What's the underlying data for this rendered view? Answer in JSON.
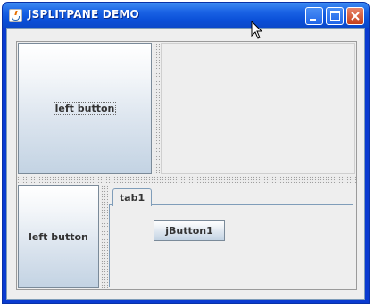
{
  "window": {
    "title": "JSPLITPANE DEMO",
    "controls": [
      "minimize",
      "maximize",
      "close"
    ]
  },
  "top_split": {
    "left_button_label": "left button"
  },
  "bottom_split": {
    "left_button_label": "left button",
    "tabs": [
      {
        "label": "tab1",
        "selected": true
      }
    ],
    "tab_button_label": "jButton1"
  },
  "icons": {
    "app": "java-coffee-cup-icon",
    "minimize": "minimize-icon",
    "maximize": "maximize-icon",
    "close": "close-icon",
    "cursor": "mouse-pointer-icon"
  },
  "colors": {
    "titlebar": "#0a4fd8",
    "close_button": "#c6401b",
    "panel_background": "#eeeeee",
    "button_gradient_bottom": "#c3d3e3"
  }
}
